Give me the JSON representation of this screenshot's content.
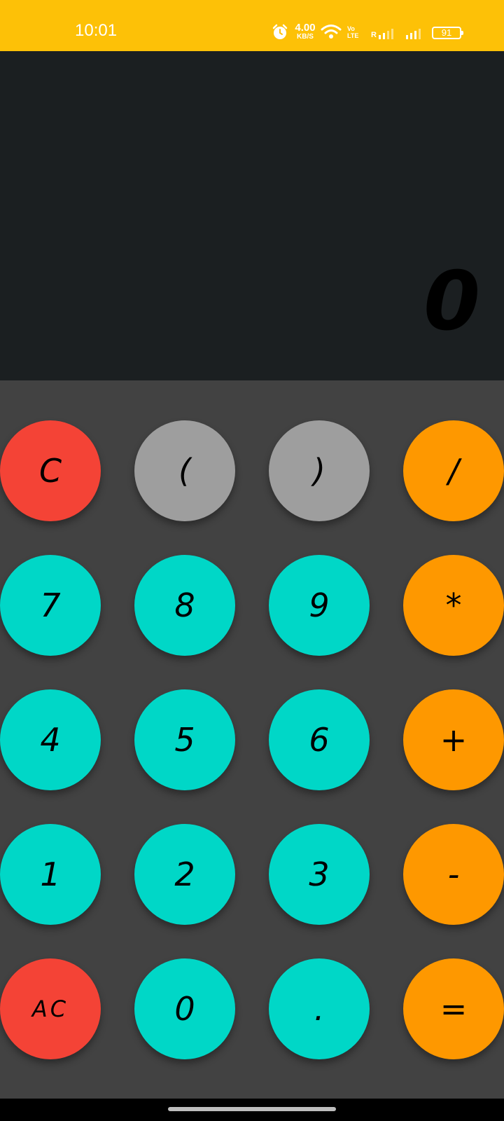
{
  "status_bar": {
    "time": "10:01",
    "net_speed_value": "4.00",
    "net_speed_unit": "KB/S",
    "volte_line1": "Vo",
    "volte_line2": "LTE",
    "roaming": "R",
    "battery_level": "91",
    "icons": [
      "alarm-icon",
      "wifi-icon",
      "signal-icon",
      "signal-icon",
      "battery-icon"
    ],
    "color": "#fdc107"
  },
  "display": {
    "result": "0"
  },
  "keypad": {
    "rows": [
      [
        {
          "label": "C",
          "color": "red"
        },
        {
          "label": "(",
          "color": "grey"
        },
        {
          "label": ")",
          "color": "grey"
        },
        {
          "label": "/",
          "color": "orange"
        }
      ],
      [
        {
          "label": "7",
          "color": "teal"
        },
        {
          "label": "8",
          "color": "teal"
        },
        {
          "label": "9",
          "color": "teal"
        },
        {
          "label": "*",
          "color": "orange"
        }
      ],
      [
        {
          "label": "4",
          "color": "teal"
        },
        {
          "label": "5",
          "color": "teal"
        },
        {
          "label": "6",
          "color": "teal"
        },
        {
          "label": "+",
          "color": "orange"
        }
      ],
      [
        {
          "label": "1",
          "color": "teal"
        },
        {
          "label": "2",
          "color": "teal"
        },
        {
          "label": "3",
          "color": "teal"
        },
        {
          "label": "-",
          "color": "orange"
        }
      ],
      [
        {
          "label": "AC",
          "color": "red"
        },
        {
          "label": "0",
          "color": "teal"
        },
        {
          "label": ".",
          "color": "teal"
        },
        {
          "label": "=",
          "color": "orange"
        }
      ]
    ]
  },
  "colors": {
    "red": "#f44336",
    "grey": "#9e9e9e",
    "teal": "#00d7c7",
    "orange": "#fe9800",
    "display_bg": "#1b1f21",
    "keypad_bg": "#424242"
  }
}
